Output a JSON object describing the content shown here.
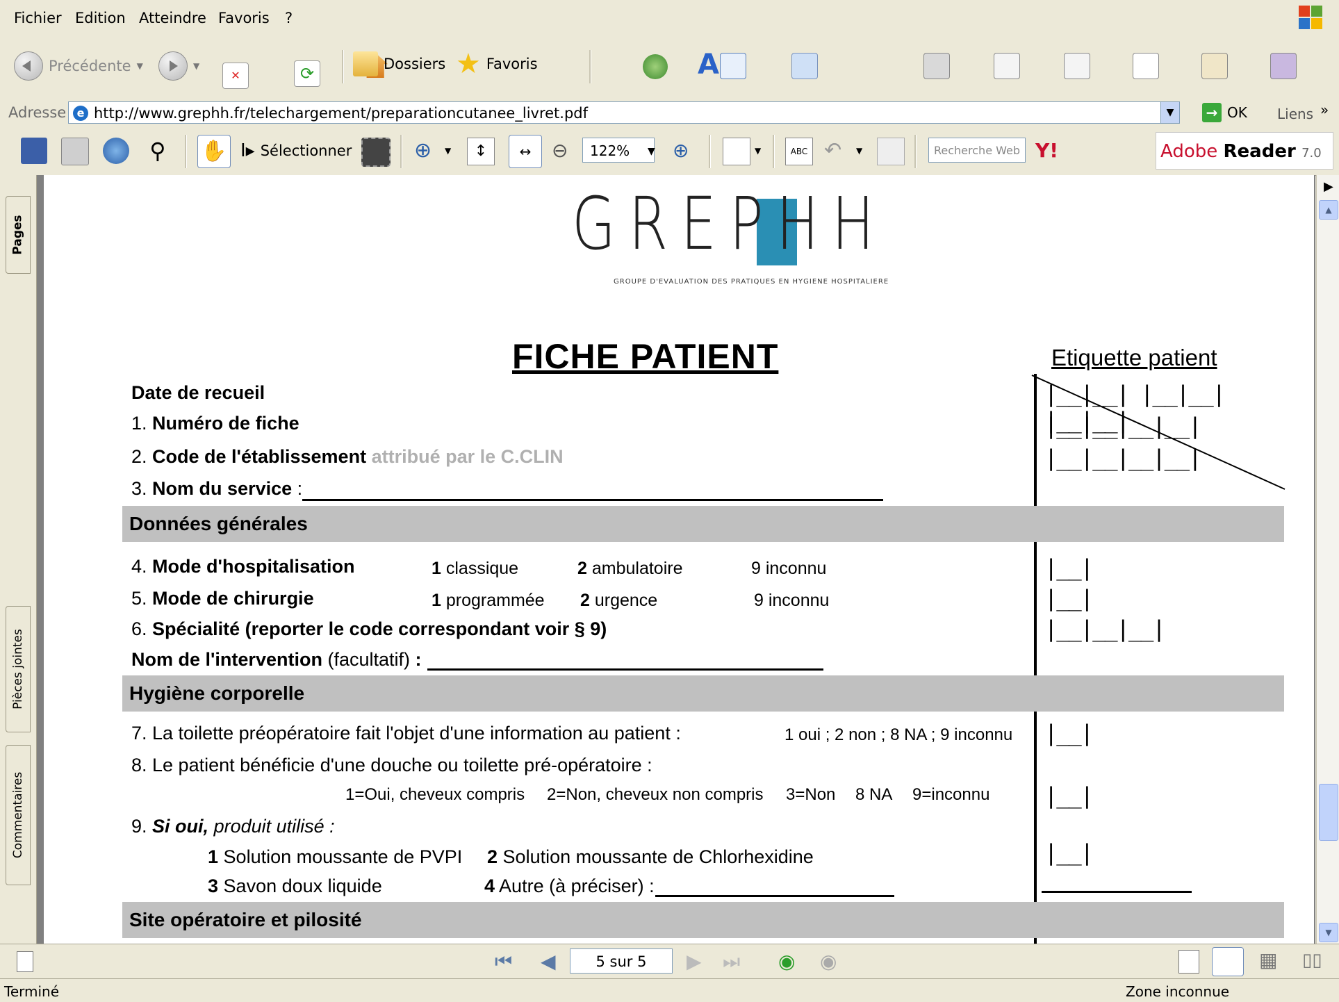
{
  "menu": [
    "Fichier",
    "Edition",
    "Atteindre",
    "Favoris",
    "?"
  ],
  "toolbar": {
    "back_label": "Précédente",
    "folders_label": "Dossiers",
    "favorites_label": "Favoris"
  },
  "address": {
    "label": "Adresse",
    "url": "http://www.grephh.fr/telechargement/preparationcutanee_livret.pdf",
    "go_label": "OK",
    "links_label": "Liens"
  },
  "adobe": {
    "select_label": "Sélectionner",
    "zoom": "122%",
    "search_placeholder": "Recherche Web",
    "brand": "Adobe",
    "product": "Reader",
    "version": "7.0"
  },
  "nav_tabs": [
    "Pages",
    "Pièces jointes",
    "Commentaires"
  ],
  "document": {
    "logo": "GREPHH",
    "logo_sub": "GROUPE D'EVALUATION DES PRATIQUES EN HYGIENE HOSPITALIERE",
    "title": "FICHE PATIENT",
    "etiquette": "Etiquette patient",
    "date_recueil": "Date de recueil",
    "q1_num": "1.",
    "q1": "Numéro de fiche",
    "q2_num": "2.",
    "q2": "Code de l'établissement",
    "q2_note": "attribué par le C.CLIN",
    "q3_num": "3.",
    "q3": "Nom du service",
    "q3_colon": ":",
    "section_general": "Données générales",
    "q4_num": "4.",
    "q4": "Mode d'hospitalisation",
    "q4_o1n": "1",
    "q4_o1": "classique",
    "q4_o2n": "2",
    "q4_o2": "ambulatoire",
    "q4_o3": "9 inconnu",
    "q5_num": "5.",
    "q5": "Mode de chirurgie",
    "q5_o1n": "1",
    "q5_o1": "programmée",
    "q5_o2n": "2",
    "q5_o2": "urgence",
    "q5_o3": "9 inconnu",
    "q6_num": "6.",
    "q6": "Spécialité (reporter le code correspondant voir § 9)",
    "intervention": "Nom de l'intervention",
    "intervention_note": "(facultatif)",
    "intervention_colon": ":",
    "section_hygiene": "Hygiène corporelle",
    "q7": "7. La toilette préopératoire fait l'objet d'une information au patient :",
    "q7_opts": "1 oui ; 2 non ; 8 NA ; 9 inconnu",
    "q8": "8. Le patient bénéficie d'une douche ou toilette pré-opératoire :",
    "q8_o1": "1=Oui, cheveux compris",
    "q8_o2": "2=Non, cheveux non compris",
    "q8_o3": "3=Non",
    "q8_o4": "8 NA",
    "q8_o5": "9=inconnu",
    "q9_num": "9.",
    "q9_bold": "Si oui,",
    "q9_rest": "produit utilisé :",
    "q9_o1n": "1",
    "q9_o1": "Solution moussante de PVPI",
    "q9_o2n": "2",
    "q9_o2": "Solution moussante de Chlorhexidine",
    "q9_o3n": "3",
    "q9_o3": "Savon doux liquide",
    "q9_o4n": "4",
    "q9_o4": "Autre (à préciser) :",
    "section_site": "Site opératoire et pilosité",
    "boxes_date": "|__|__| |__|__| |__|__|",
    "boxes_fiche": "|__|__|__|__|",
    "boxes_code": "|__|__|__|__|",
    "box1": "|__|",
    "boxes_spec": "|__|__|__|"
  },
  "pagenav": {
    "page_label": "5 sur 5"
  },
  "status": {
    "left": "Terminé",
    "zone": "Zone inconnue"
  }
}
